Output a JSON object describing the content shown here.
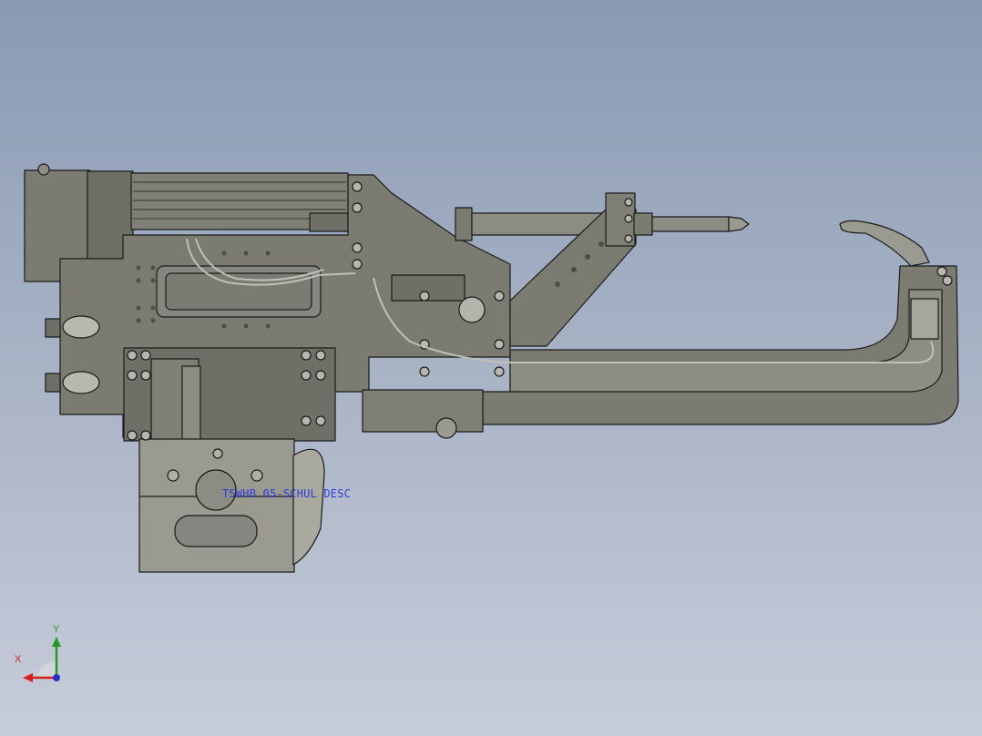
{
  "viewport": {
    "background_top": "#8a9ab3",
    "background_bottom": "#c7ccd9",
    "part_color": "#7b7b72",
    "part_light": "#9a9a90",
    "part_dark": "#5e5e56",
    "edge_color": "#1a1a1a"
  },
  "annotation": {
    "label": "TSWHB 05-SCHUL DESC",
    "color": "#2d3bd8"
  },
  "triad": {
    "x_label": "X",
    "y_label": "Y",
    "x_color": "#d3211a",
    "y_color": "#1f9a25",
    "z_color": "#2633c9"
  }
}
